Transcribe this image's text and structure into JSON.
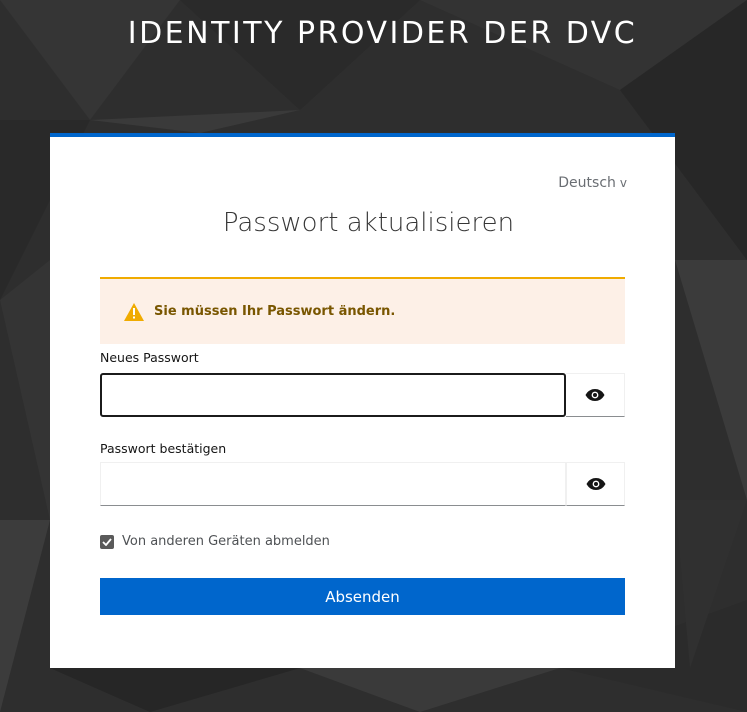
{
  "header": {
    "title": "IDENTITY PROVIDER DER DVC"
  },
  "locale": {
    "current": "Deutsch",
    "chevron": "v"
  },
  "form": {
    "title": "Passwort aktualisieren",
    "alert": {
      "type": "warning",
      "icon": "warning-triangle-icon",
      "message": "Sie müssen Ihr Passwort ändern."
    },
    "new_password": {
      "label": "Neues Passwort",
      "value": "",
      "placeholder": "",
      "toggle_icon": "eye-icon"
    },
    "confirm_password": {
      "label": "Passwort bestätigen",
      "value": "",
      "placeholder": "",
      "toggle_icon": "eye-icon"
    },
    "logout_other_devices": {
      "label": "Von anderen Geräten abmelden",
      "checked": true
    },
    "submit_label": "Absenden"
  },
  "colors": {
    "accent": "#0066cc",
    "warning": "#f0ab00",
    "alert_bg": "#fdf0e7",
    "alert_text": "#795600",
    "background": "#2f2f2f"
  }
}
